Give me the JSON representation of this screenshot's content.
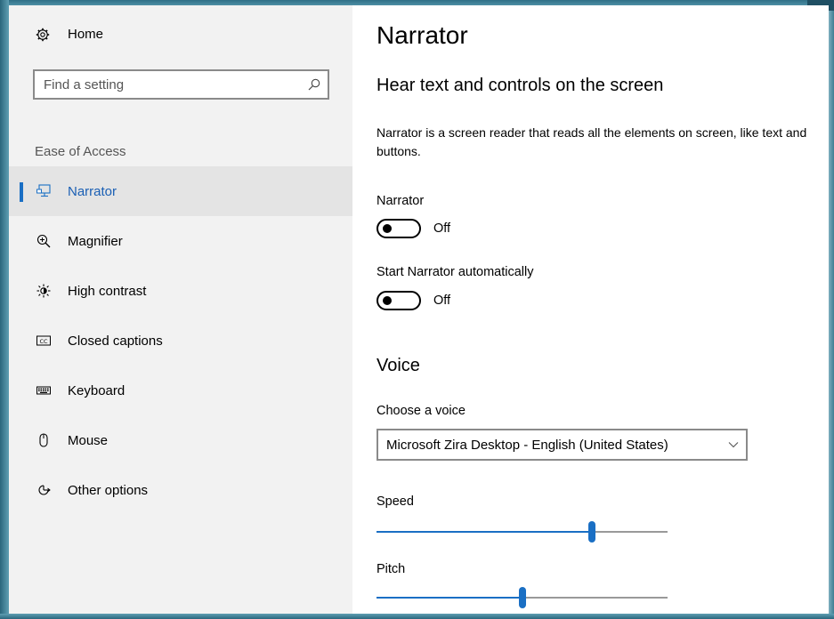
{
  "sidebar": {
    "home_label": "Home",
    "search_placeholder": "Find a setting",
    "section_label": "Ease of Access",
    "items": [
      {
        "label": "Narrator",
        "icon": "narrator-icon",
        "selected": true
      },
      {
        "label": "Magnifier",
        "icon": "magnifier-icon"
      },
      {
        "label": "High contrast",
        "icon": "high-contrast-icon"
      },
      {
        "label": "Closed captions",
        "icon": "closed-captions-icon"
      },
      {
        "label": "Keyboard",
        "icon": "keyboard-icon"
      },
      {
        "label": "Mouse",
        "icon": "mouse-icon"
      },
      {
        "label": "Other options",
        "icon": "other-options-icon"
      }
    ]
  },
  "main": {
    "title": "Narrator",
    "subtitle": "Hear text and controls on the screen",
    "description": "Narrator is a screen reader that reads all the elements on screen, like text and buttons.",
    "narrator_toggle": {
      "label": "Narrator",
      "state": "Off"
    },
    "auto_start_toggle": {
      "label": "Start Narrator automatically",
      "state": "Off"
    },
    "voice_heading": "Voice",
    "voice": {
      "label": "Choose a voice",
      "selected": "Microsoft Zira Desktop - English (United States)"
    },
    "speed": {
      "label": "Speed",
      "value": 0.74
    },
    "pitch": {
      "label": "Pitch",
      "value": 0.5
    }
  },
  "colors": {
    "accent": "#1a6fc4",
    "sidebar_bg": "#f2f2f2",
    "selected_bg": "#e4e4e4",
    "frame": "#3f7d92"
  }
}
